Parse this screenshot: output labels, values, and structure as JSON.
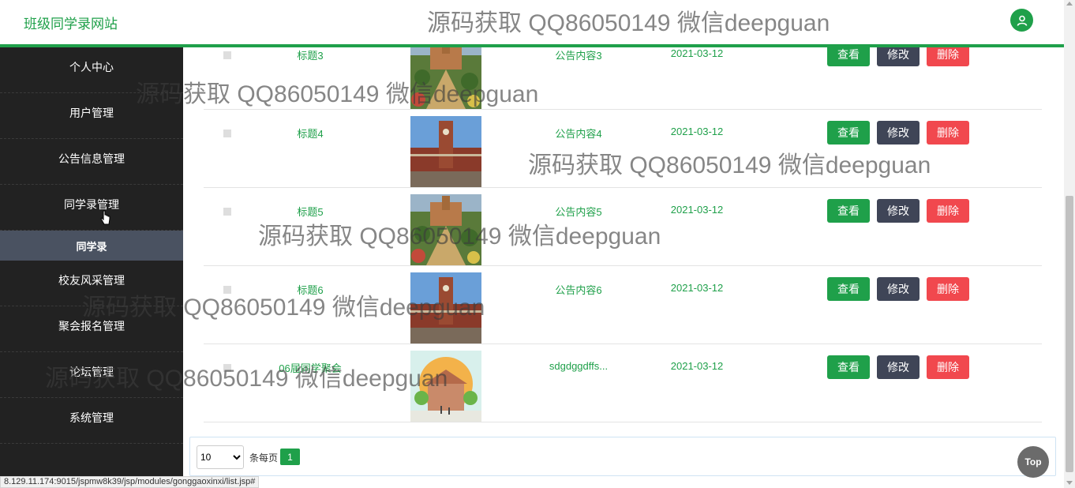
{
  "header": {
    "site_title": "班级同学录网站",
    "icon": "user-icon"
  },
  "sidebar": {
    "items": [
      {
        "label": "个人中心"
      },
      {
        "label": "用户管理"
      },
      {
        "label": "公告信息管理"
      },
      {
        "label": "同学录管理"
      },
      {
        "label": "校友风采管理"
      },
      {
        "label": "聚会报名管理"
      },
      {
        "label": "论坛管理"
      },
      {
        "label": "系统管理"
      }
    ],
    "active_sub": "同学录"
  },
  "table": {
    "rows": [
      {
        "title": "标题3",
        "content": "公告内容3",
        "date": "2021-03-12",
        "image": "garden-building-image"
      },
      {
        "title": "标题4",
        "content": "公告内容4",
        "date": "2021-03-12",
        "image": "clock-tower-image"
      },
      {
        "title": "标题5",
        "content": "公告内容5",
        "date": "2021-03-12",
        "image": "garden-building-image"
      },
      {
        "title": "标题6",
        "content": "公告内容6",
        "date": "2021-03-12",
        "image": "clock-tower-image"
      },
      {
        "title": "06届同学聚会",
        "content": "sdgdggdffs...",
        "date": "2021-03-12",
        "image": "school-illustration-image"
      }
    ],
    "actions": {
      "view": "查看",
      "edit": "修改",
      "delete": "删除"
    }
  },
  "pagination": {
    "page_size": "10",
    "per_page_label": "条每页",
    "current_page": "1"
  },
  "top_button": "Top",
  "status_url": "8.129.11.174:9015/jspmw8k39/jsp/modules/gonggaoxinxi/list.jsp#",
  "watermark": "源码获取 QQ86050149 微信deepguan",
  "colors": {
    "accent": "#1fa04a",
    "sidebar_bg": "#222222",
    "edit": "#3f4557",
    "delete": "#f1484e"
  }
}
